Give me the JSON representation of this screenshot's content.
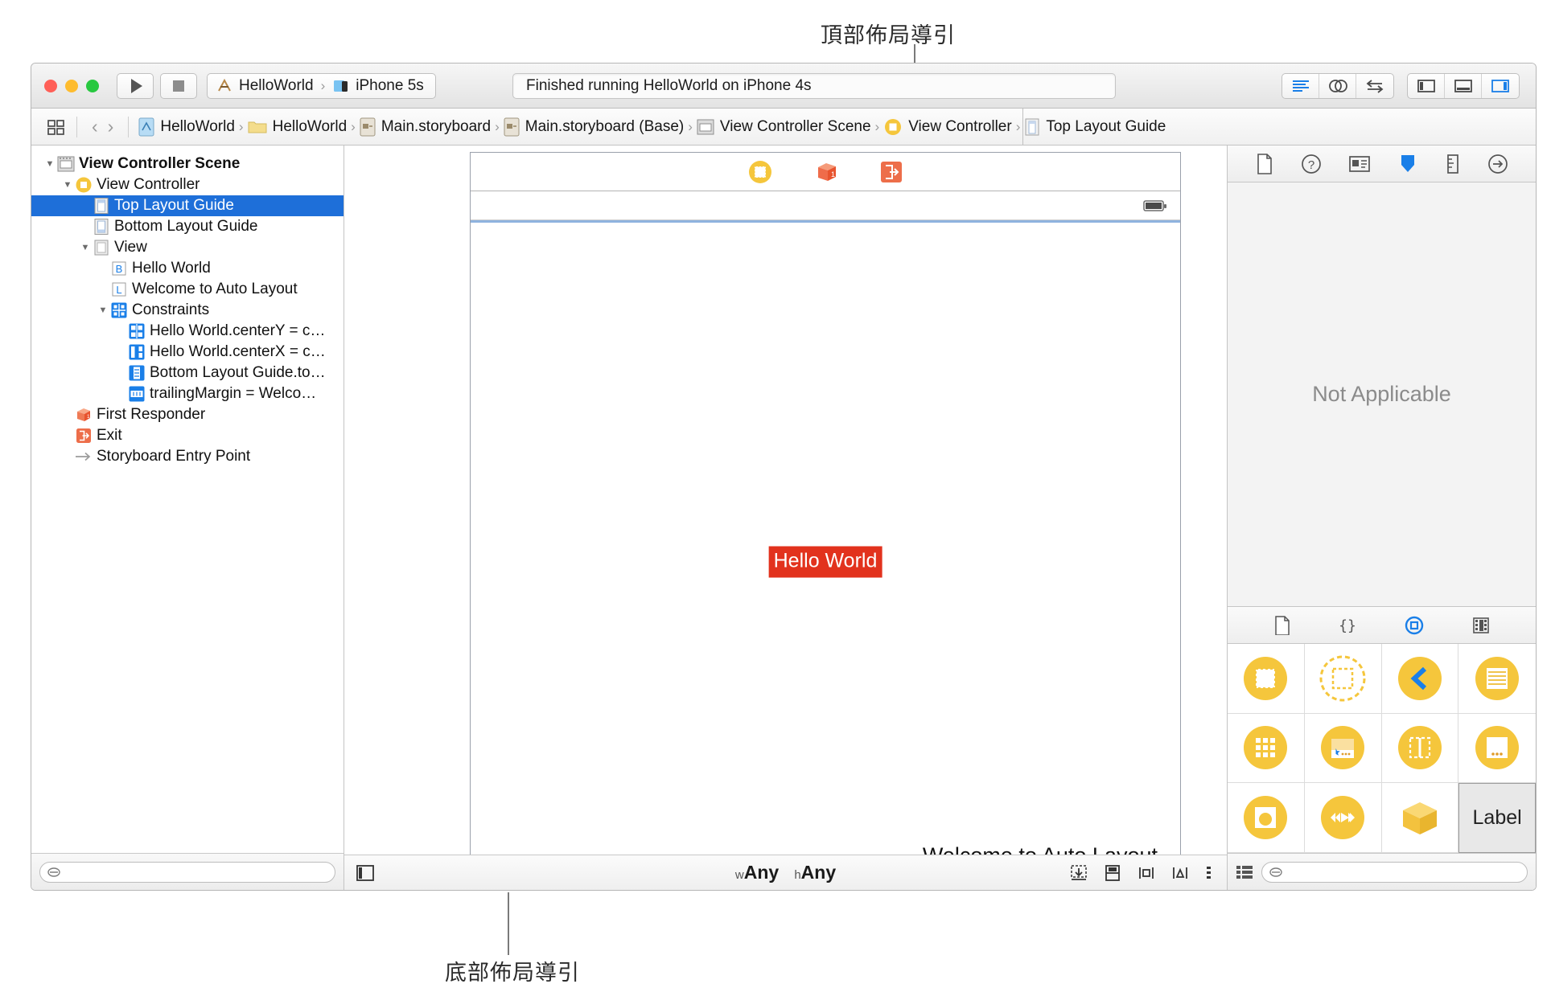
{
  "annotations": {
    "top": "頂部佈局導引",
    "bottom": "底部佈局導引"
  },
  "toolbar": {
    "run_label": "run-button",
    "stop_label": "stop-button",
    "scheme_project": "HelloWorld",
    "scheme_destination": "iPhone 5s",
    "scheme_chevron": "›",
    "status_text": "Finished running HelloWorld on iPhone 4s",
    "editor_buttons": [
      "standard-editor",
      "assistant-editor",
      "version-editor"
    ],
    "view_buttons": [
      "navigator-toggle",
      "debug-toggle",
      "utilities-toggle"
    ],
    "accent_blue": "#1a7fe8"
  },
  "jumpbar": {
    "back": "‹",
    "forward": "›",
    "separator": "›",
    "crumbs": [
      {
        "label": "HelloWorld",
        "icon": "project-icon"
      },
      {
        "label": "HelloWorld",
        "icon": "folder-icon"
      },
      {
        "label": "Main.storyboard",
        "icon": "storyboard-icon"
      },
      {
        "label": "Main.storyboard (Base)",
        "icon": "storyboard-icon"
      },
      {
        "label": "View Controller Scene",
        "icon": "scene-icon"
      },
      {
        "label": "View Controller",
        "icon": "view-controller-icon"
      },
      {
        "label": "Top Layout Guide",
        "icon": "layout-guide-icon"
      }
    ]
  },
  "outline": {
    "items": [
      {
        "label": "View Controller Scene",
        "indent": 0,
        "disclosure": "open",
        "icon": "scene-icon",
        "bold": true,
        "selected": false
      },
      {
        "label": "View Controller",
        "indent": 1,
        "disclosure": "open",
        "icon": "view-controller-icon",
        "bold": false,
        "selected": false
      },
      {
        "label": "Top Layout Guide",
        "indent": 2,
        "disclosure": "none",
        "icon": "top-guide-icon",
        "bold": false,
        "selected": true
      },
      {
        "label": "Bottom Layout Guide",
        "indent": 2,
        "disclosure": "none",
        "icon": "bottom-guide-icon",
        "bold": false,
        "selected": false
      },
      {
        "label": "View",
        "indent": 2,
        "disclosure": "open",
        "icon": "view-icon",
        "bold": false,
        "selected": false
      },
      {
        "label": "Hello World",
        "indent": 3,
        "disclosure": "none",
        "icon": "button-icon",
        "bold": false,
        "selected": false
      },
      {
        "label": "Welcome to Auto Layout",
        "indent": 3,
        "disclosure": "none",
        "icon": "label-icon",
        "bold": false,
        "selected": false
      },
      {
        "label": "Constraints",
        "indent": 3,
        "disclosure": "open",
        "icon": "constraints-icon",
        "bold": false,
        "selected": false
      },
      {
        "label": "Hello World.centerY = c…",
        "indent": 4,
        "disclosure": "none",
        "icon": "constraint-centery-icon",
        "bold": false,
        "selected": false
      },
      {
        "label": "Hello World.centerX = c…",
        "indent": 4,
        "disclosure": "none",
        "icon": "constraint-centerx-icon",
        "bold": false,
        "selected": false
      },
      {
        "label": "Bottom Layout Guide.to…",
        "indent": 4,
        "disclosure": "none",
        "icon": "constraint-vertical-icon",
        "bold": false,
        "selected": false
      },
      {
        "label": "trailingMargin = Welco…",
        "indent": 4,
        "disclosure": "none",
        "icon": "constraint-horizontal-icon",
        "bold": false,
        "selected": false
      },
      {
        "label": "First Responder",
        "indent": 1,
        "disclosure": "none",
        "icon": "first-responder-icon",
        "bold": false,
        "selected": false
      },
      {
        "label": "Exit",
        "indent": 1,
        "disclosure": "none",
        "icon": "exit-icon",
        "bold": false,
        "selected": false
      },
      {
        "label": "Storyboard Entry Point",
        "indent": 1,
        "disclosure": "none",
        "icon": "entry-point-icon",
        "bold": false,
        "selected": false
      }
    ],
    "filter_placeholder": ""
  },
  "canvas": {
    "dock_icons": [
      "view-controller-icon",
      "first-responder-icon",
      "exit-icon"
    ],
    "status_battery": "battery-icon",
    "hello_button_label": "Hello World",
    "hello_button_bg": "#e2321d",
    "hello_button_fg": "#ffffff",
    "welcome_label": "Welcome to Auto Layout",
    "top_guide_color": "#8fb3df",
    "size_class_w_prefix": "w",
    "size_class_w": "Any",
    "size_class_h_prefix": "h",
    "size_class_h": "Any",
    "autolayout_icons": [
      "update-frames-icon",
      "embed-in-icon",
      "align-icon",
      "pin-icon",
      "resolve-issues-icon"
    ]
  },
  "utilities": {
    "inspector_tabs": [
      "file-inspector-icon",
      "quick-help-icon",
      "identity-inspector-icon",
      "attributes-inspector-icon",
      "size-inspector-icon",
      "connections-inspector-icon"
    ],
    "inspector_selected": "attributes-inspector-icon",
    "empty_message": "Not Applicable",
    "library_tabs": [
      "file-template-library-icon",
      "code-snippet-library-icon",
      "object-library-icon",
      "media-library-icon"
    ],
    "library_selected": "object-library-icon",
    "library_objects": [
      {
        "name": "view-controller-object",
        "label": ""
      },
      {
        "name": "container-view-object",
        "label": ""
      },
      {
        "name": "navigation-controller-object",
        "label": ""
      },
      {
        "name": "table-view-controller-object",
        "label": ""
      },
      {
        "name": "collection-view-controller-object",
        "label": ""
      },
      {
        "name": "tab-bar-controller-object",
        "label": ""
      },
      {
        "name": "split-view-controller-object",
        "label": ""
      },
      {
        "name": "page-view-controller-object",
        "label": ""
      },
      {
        "name": "glkit-view-controller-object",
        "label": ""
      },
      {
        "name": "avkit-player-controller-object",
        "label": ""
      },
      {
        "name": "object-cube-object",
        "label": ""
      },
      {
        "name": "label-object",
        "label": "Label"
      }
    ],
    "library_selected_object": "label-object",
    "library_filter_placeholder": ""
  }
}
